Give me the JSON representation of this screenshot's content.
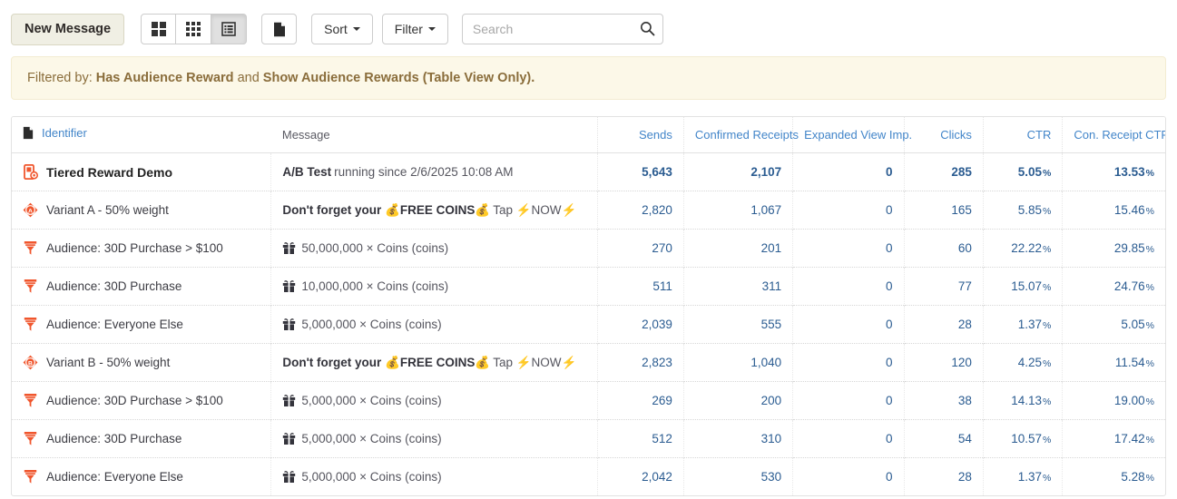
{
  "toolbar": {
    "new_message_label": "New Message",
    "view_buttons": [
      {
        "name": "large-cards-view",
        "icon": "grid-2x2-icon",
        "active": false
      },
      {
        "name": "small-cards-view",
        "icon": "grid-3x3-icon",
        "active": false
      },
      {
        "name": "table-view",
        "icon": "list-view-icon",
        "active": true
      }
    ],
    "page_button_icon": "document-page-icon",
    "sort_label": "Sort",
    "filter_label": "Filter",
    "search_placeholder": "Search",
    "search_value": "",
    "search_icon": "search-icon"
  },
  "filter_banner": {
    "prefix": "Filtered by:",
    "filter_one": "Has Audience Reward",
    "conjunction": "and",
    "filter_two": "Show Audience Rewards (Table View Only).",
    "bg_color": "#fcf8e8",
    "text_color": "#8a6d3b"
  },
  "table": {
    "header_icon": "document-page-icon",
    "columns": [
      {
        "key": "identifier",
        "label": "Identifier",
        "link": true
      },
      {
        "key": "message",
        "label": "Message",
        "link": false
      },
      {
        "key": "sends",
        "label": "Sends",
        "link": true
      },
      {
        "key": "confirmed_receipts",
        "label": "Confirmed Receipts",
        "link": true
      },
      {
        "key": "expanded_view_imp",
        "label": "Expanded View Imp.",
        "link": true
      },
      {
        "key": "clicks",
        "label": "Clicks",
        "link": true
      },
      {
        "key": "ctr",
        "label": "CTR",
        "link": true
      },
      {
        "key": "con_receipt_ctr",
        "label": "Con. Receipt CTR",
        "link": true
      }
    ],
    "rows": [
      {
        "type": "parent",
        "icon": "ab-test-device-icon",
        "identifier": "Tiered Reward Demo",
        "message_bold": "A/B Test",
        "message_rest": " running since 2/6/2025 10:08 AM",
        "sends": "5,643",
        "confirmed_receipts": "2,107",
        "expanded_view_imp": "0",
        "clicks": "285",
        "ctr": "5.05",
        "con_receipt_ctr": "13.53"
      },
      {
        "type": "variant",
        "icon": "variant-a-icon",
        "identifier": "Variant A - 50% weight",
        "message_bold": "Don't forget your 💰FREE COINS💰",
        "message_rest": " Tap ⚡NOW⚡",
        "sends": "2,820",
        "confirmed_receipts": "1,067",
        "expanded_view_imp": "0",
        "clicks": "165",
        "ctr": "5.85",
        "con_receipt_ctr": "15.46"
      },
      {
        "type": "audience",
        "icon": "funnel-icon",
        "identifier": "Audience: 30D Purchase > $100",
        "message_gift": "🎁",
        "message_rest": "50,000,000 × Coins (coins)",
        "sends": "270",
        "confirmed_receipts": "201",
        "expanded_view_imp": "0",
        "clicks": "60",
        "ctr": "22.22",
        "con_receipt_ctr": "29.85"
      },
      {
        "type": "audience",
        "icon": "funnel-icon",
        "identifier": "Audience: 30D Purchase",
        "message_gift": "🎁",
        "message_rest": "10,000,000 × Coins (coins)",
        "sends": "511",
        "confirmed_receipts": "311",
        "expanded_view_imp": "0",
        "clicks": "77",
        "ctr": "15.07",
        "con_receipt_ctr": "24.76"
      },
      {
        "type": "audience",
        "icon": "funnel-icon",
        "identifier": "Audience: Everyone Else",
        "message_gift": "🎁",
        "message_rest": "5,000,000 × Coins (coins)",
        "sends": "2,039",
        "confirmed_receipts": "555",
        "expanded_view_imp": "0",
        "clicks": "28",
        "ctr": "1.37",
        "con_receipt_ctr": "5.05"
      },
      {
        "type": "variant",
        "icon": "variant-b-icon",
        "identifier": "Variant B - 50% weight",
        "message_bold": "Don't forget your 💰FREE COINS💰",
        "message_rest": " Tap ⚡NOW⚡",
        "sends": "2,823",
        "confirmed_receipts": "1,040",
        "expanded_view_imp": "0",
        "clicks": "120",
        "ctr": "4.25",
        "con_receipt_ctr": "11.54"
      },
      {
        "type": "audience",
        "icon": "funnel-icon",
        "identifier": "Audience: 30D Purchase > $100",
        "message_gift": "🎁",
        "message_rest": "5,000,000 × Coins (coins)",
        "sends": "269",
        "confirmed_receipts": "200",
        "expanded_view_imp": "0",
        "clicks": "38",
        "ctr": "14.13",
        "con_receipt_ctr": "19.00"
      },
      {
        "type": "audience",
        "icon": "funnel-icon",
        "identifier": "Audience: 30D Purchase",
        "message_gift": "🎁",
        "message_rest": "5,000,000 × Coins (coins)",
        "sends": "512",
        "confirmed_receipts": "310",
        "expanded_view_imp": "0",
        "clicks": "54",
        "ctr": "10.57",
        "con_receipt_ctr": "17.42"
      },
      {
        "type": "audience",
        "icon": "funnel-icon",
        "identifier": "Audience: Everyone Else",
        "message_gift": "🎁",
        "message_rest": "5,000,000 × Coins (coins)",
        "sends": "2,042",
        "confirmed_receipts": "530",
        "expanded_view_imp": "0",
        "clicks": "28",
        "ctr": "1.37",
        "con_receipt_ctr": "5.28"
      }
    ],
    "percent_symbol": "%"
  },
  "colors": {
    "link_blue": "#4285c9",
    "value_blue": "#2b5c91",
    "accent_orange": "#f0562d",
    "banner_bg": "#fcf8e8",
    "banner_text": "#8a6d3b"
  }
}
